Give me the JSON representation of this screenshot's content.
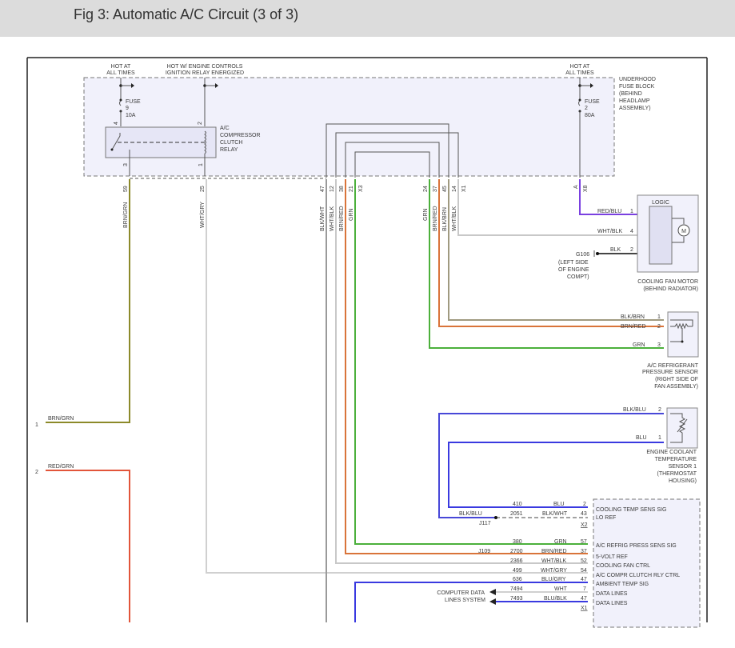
{
  "header": {
    "title": "Fig 3: Automatic A/C Circuit (3 of 3)"
  },
  "power": {
    "hot_at_all_times_left": [
      "HOT AT",
      "ALL TIMES"
    ],
    "hot_ignition": [
      "HOT W/ ENGINE CONTROLS",
      "IGNITION RELAY ENERGIZED"
    ],
    "hot_at_all_times_right": [
      "HOT AT",
      "ALL TIMES"
    ]
  },
  "fuse_block": {
    "label": [
      "UNDERHOOD",
      "FUSE BLOCK",
      "(BEHIND",
      "HEADLAMP",
      "ASSEMBLY)"
    ],
    "fuse9": [
      "FUSE",
      "9",
      "10A"
    ],
    "fuse2": [
      "FUSE",
      "2",
      "80A"
    ],
    "relay": {
      "label": [
        "A/C",
        "COMPRESSOR",
        "CLUTCH",
        "RELAY"
      ],
      "pins": [
        "4",
        "2",
        "3",
        "1"
      ]
    }
  },
  "connector_wires": [
    {
      "pin": "59",
      "color": "BRN/GRN"
    },
    {
      "pin": "25",
      "color": "WHT/GRY"
    },
    {
      "pin": "47",
      "color": "BLK/WHT"
    },
    {
      "pin": "12",
      "color": "WHT/BLK"
    },
    {
      "pin": "38",
      "color": "BRN/RED"
    },
    {
      "pin": "21",
      "color": "GRN"
    },
    {
      "pin": "X3",
      "color": ""
    },
    {
      "pin": "24",
      "color": "GRN"
    },
    {
      "pin": "37",
      "color": "BRN/RED"
    },
    {
      "pin": "45",
      "color": "BLK/BRN"
    },
    {
      "pin": "14",
      "color": "WHT/BLK"
    },
    {
      "pin": "X1",
      "color": ""
    },
    {
      "pin": "A",
      "color": ""
    },
    {
      "pin": "X8",
      "color": ""
    }
  ],
  "left_refs": [
    {
      "num": "1",
      "color": "BRN/GRN"
    },
    {
      "num": "2",
      "color": "RED/GRN"
    }
  ],
  "fan_motor": {
    "logic": "LOGIC",
    "motor_symbol": "M",
    "label": [
      "COOLING FAN MOTOR",
      "(BEHIND RADIATOR)"
    ],
    "pins": [
      {
        "color": "RED/BLU",
        "pin": "1"
      },
      {
        "color": "WHT/BLK",
        "pin": "4"
      },
      {
        "color": "BLK",
        "pin": "2"
      }
    ],
    "ground": {
      "id": "G106",
      "label": [
        "(LEFT SIDE",
        "OF ENGINE",
        "COMPT)"
      ]
    }
  },
  "pressure_sensor": {
    "label": [
      "A/C REFRIGERANT",
      "PRESSURE SENSOR",
      "(RIGHT SIDE OF",
      "FAN ASSEMBLY)"
    ],
    "pins": [
      {
        "color": "BLK/BRN",
        "pin": "1"
      },
      {
        "color": "BRN/RED",
        "pin": "2"
      },
      {
        "color": "GRN",
        "pin": "3"
      }
    ]
  },
  "ect_sensor": {
    "label": [
      "ENGINE COOLANT",
      "TEMPERATURE",
      "SENSOR 1",
      "(THERMOSTAT",
      "HOUSING)"
    ],
    "pins": [
      {
        "color": "BLK/BLU",
        "pin": "2"
      },
      {
        "color": "BLU",
        "pin": "1"
      }
    ]
  },
  "pcm": {
    "x2_rows": [
      {
        "circuit": "410",
        "color": "BLU",
        "pin": "2",
        "signal": "COOLING TEMP SENS SIG"
      },
      {
        "circuit": "2051",
        "color": "BLK/WHT",
        "pin": "43",
        "signal": "LO REF"
      }
    ],
    "x2_label": "X2",
    "splice_j117": "J117",
    "splice_j117_wire": "BLK/BLU",
    "x1_rows": [
      {
        "circuit": "380",
        "color": "GRN",
        "pin": "57",
        "signal": "A/C REFRIG PRESS SENS SIG"
      },
      {
        "circuit": "2700",
        "color": "BRN/RED",
        "pin": "37",
        "signal": "5-VOLT REF"
      },
      {
        "circuit": "2366",
        "color": "WHT/BLK",
        "pin": "52",
        "signal": "COOLING FAN CTRL"
      },
      {
        "circuit": "499",
        "color": "WHT/GRY",
        "pin": "54",
        "signal": "A/C COMPR CLUTCH RLY CTRL"
      },
      {
        "circuit": "636",
        "color": "BLU/GRY",
        "pin": "47",
        "signal": "AMBIENT TEMP SIG"
      },
      {
        "circuit": "7494",
        "color": "WHT",
        "pin": "7",
        "signal": "DATA LINES"
      },
      {
        "circuit": "7493",
        "color": "BLU/BLK",
        "pin": "47",
        "signal": "DATA LINES"
      }
    ],
    "x1_label": "X1",
    "splice_j109": "J109",
    "data_lines_ref": [
      "COMPUTER DATA",
      "LINES SYSTEM"
    ]
  },
  "wire_colors": {
    "brn_grn": "#8c8a2a",
    "wht_gry": "#d0d0d0",
    "red_grn": "#e2553a",
    "grn": "#4cb03c",
    "brn_red": "#d9743a",
    "blk_brn": "#a09a80",
    "wht_blk": "#c8c8c8",
    "blk_wht": "#9a9a9a",
    "blu": "#3a3ae0",
    "red_blu": "#7a40e0",
    "blk": "#444444"
  }
}
